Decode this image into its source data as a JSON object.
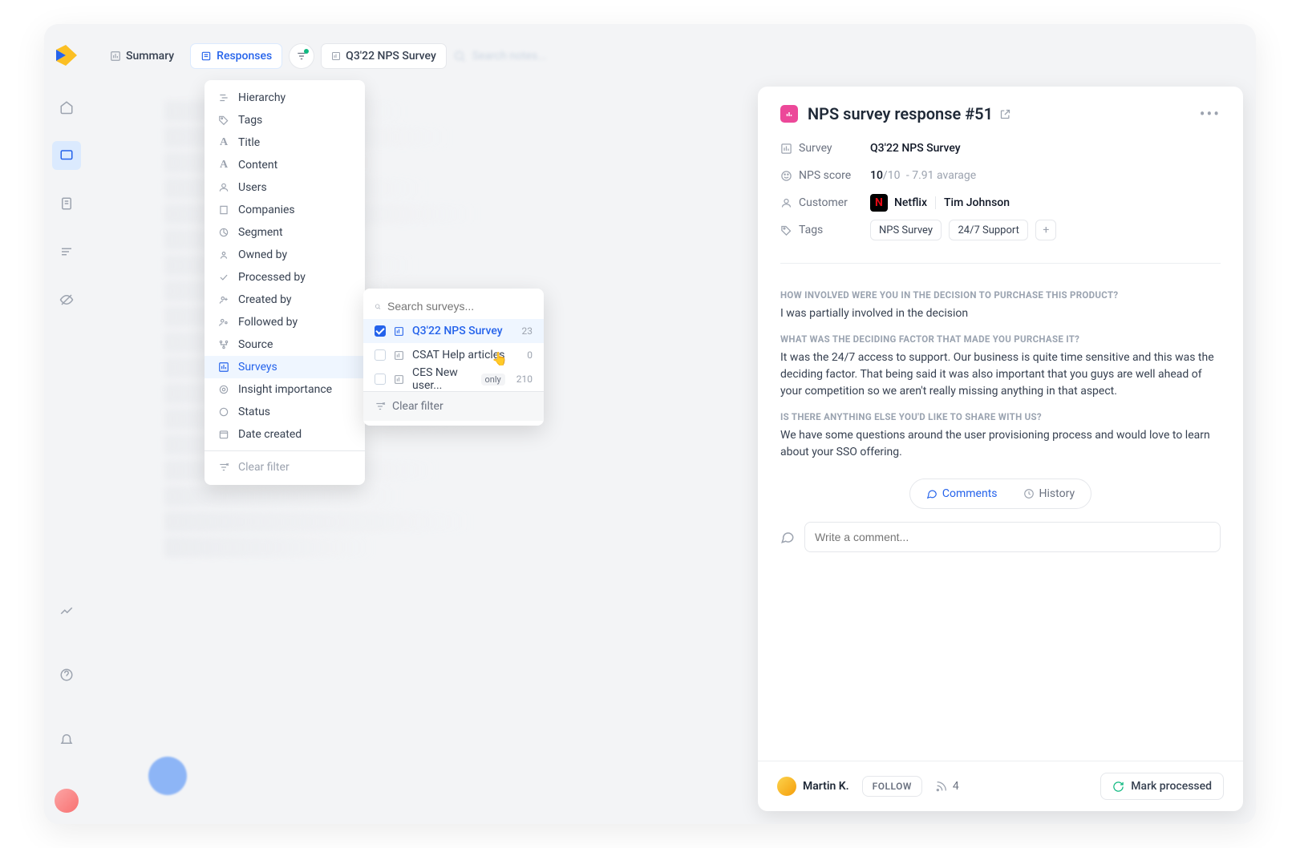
{
  "topbar": {
    "summary_label": "Summary",
    "responses_label": "Responses",
    "current_filter_label": "Q3'22 NPS Survey",
    "search_placeholder": "Search notes..."
  },
  "filter_menu": {
    "items": [
      {
        "icon": "hierarchy-icon",
        "label": "Hierarchy"
      },
      {
        "icon": "tag-icon",
        "label": "Tags"
      },
      {
        "icon": "title-icon",
        "label": "Title"
      },
      {
        "icon": "content-icon",
        "label": "Content"
      },
      {
        "icon": "users-icon",
        "label": "Users"
      },
      {
        "icon": "company-icon",
        "label": "Companies"
      },
      {
        "icon": "segment-icon",
        "label": "Segment"
      },
      {
        "icon": "owner-icon",
        "label": "Owned by"
      },
      {
        "icon": "processed-icon",
        "label": "Processed by"
      },
      {
        "icon": "created-icon",
        "label": "Created by"
      },
      {
        "icon": "followed-icon",
        "label": "Followed by"
      },
      {
        "icon": "source-icon",
        "label": "Source"
      },
      {
        "icon": "survey-icon",
        "label": "Surveys",
        "selected": true
      },
      {
        "icon": "importance-icon",
        "label": "Insight importance"
      },
      {
        "icon": "status-icon",
        "label": "Status"
      },
      {
        "icon": "date-icon",
        "label": "Date created"
      }
    ],
    "clear_label": "Clear filter"
  },
  "survey_submenu": {
    "search_placeholder": "Search surveys...",
    "options": [
      {
        "label": "Q3'22 NPS Survey",
        "count": "23",
        "selected": true
      },
      {
        "label": "CSAT Help articles",
        "count": "0"
      },
      {
        "label": "CES New user...",
        "count": "210",
        "only": true
      }
    ],
    "clear_label": "Clear filter"
  },
  "detail": {
    "title": "NPS survey response #51",
    "meta": {
      "survey_label": "Survey",
      "survey_value": "Q3'22 NPS Survey",
      "nps_label": "NPS score",
      "nps_score": "10",
      "nps_max": "/10",
      "nps_avg": " - 7.91 avarage",
      "customer_label": "Customer",
      "customer_company": "Netflix",
      "customer_person": "Tim Johnson",
      "tags_label": "Tags",
      "tags": [
        "NPS Survey",
        "24/7 Support"
      ]
    },
    "qa": [
      {
        "q": "HOW INVOLVED WERE YOU IN THE DECISION TO PURCHASE THIS PRODUCT?",
        "a": "I was partially involved in the decision"
      },
      {
        "q": "WHAT WAS THE DECIDING FACTOR THAT MADE YOU PURCHASE IT?",
        "a": "It was the 24/7 access to support. Our business is quite time sensitive and this was the deciding factor. That being said it was also important that you guys are well ahead of your competition so we aren't really missing anything in that aspect."
      },
      {
        "q": "IS THERE ANYTHING ELSE YOU'D LIKE TO SHARE WITH US?",
        "a": "We have some questions around the user provisioning process and would love to learn about your SSO offering."
      }
    ],
    "tabs": {
      "comments": "Comments",
      "history": "History"
    },
    "comment_placeholder": "Write a comment...",
    "footer": {
      "assignee": "Martin K.",
      "follow_label": "FOLLOW",
      "follower_count": "4",
      "mark_label": "Mark processed"
    }
  }
}
